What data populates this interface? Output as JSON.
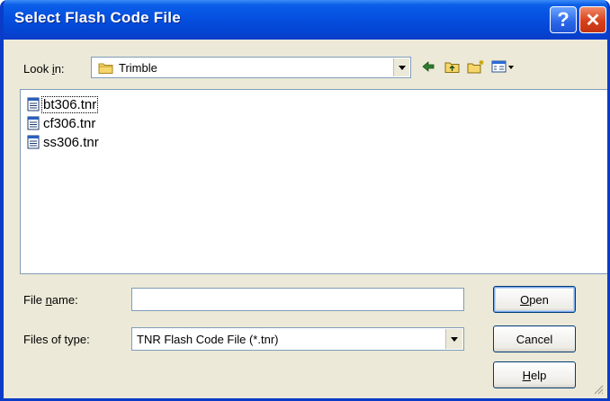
{
  "window": {
    "title": "Select Flash Code File"
  },
  "title_buttons": {
    "help": "?",
    "close": "✕"
  },
  "look_in": {
    "label_prefix": "Look ",
    "label_access": "i",
    "label_suffix": "n:",
    "value": "Trimble"
  },
  "toolbar": {
    "icons": [
      "back-icon",
      "up-folder-icon",
      "new-folder-icon",
      "view-menu-icon"
    ]
  },
  "files": [
    {
      "name": "bt306.tnr",
      "selected": true
    },
    {
      "name": "cf306.tnr",
      "selected": false
    },
    {
      "name": "ss306.tnr",
      "selected": false
    }
  ],
  "file_name": {
    "label_prefix": "File ",
    "label_access": "n",
    "label_suffix": "ame:",
    "value": ""
  },
  "file_type": {
    "label": "Files of type:",
    "value": "TNR Flash Code File (*.tnr)"
  },
  "buttons": {
    "open_access": "O",
    "open_rest": "pen",
    "cancel": "Cancel",
    "help_access": "H",
    "help_rest": "elp"
  },
  "colors": {
    "titlebar": "#0550e0",
    "dialog_bg": "#ece9d8",
    "border": "#7f9db9"
  }
}
